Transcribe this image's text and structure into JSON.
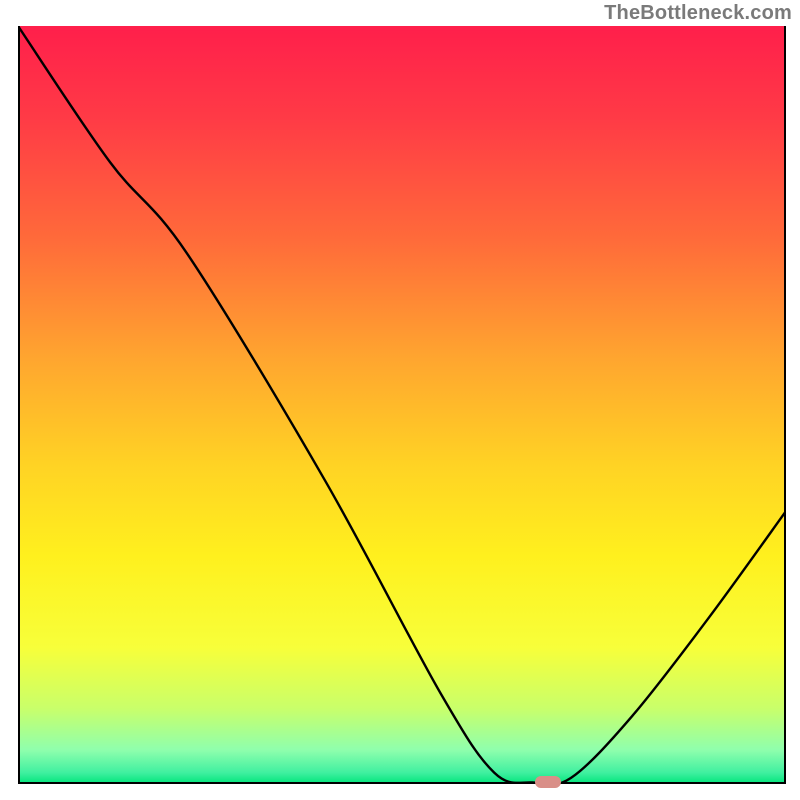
{
  "watermark": "TheBottleneck.com",
  "colors": {
    "gradient_stops": [
      {
        "offset": 0.0,
        "color": "#ff1f4b"
      },
      {
        "offset": 0.12,
        "color": "#ff3a46"
      },
      {
        "offset": 0.28,
        "color": "#ff6a3a"
      },
      {
        "offset": 0.44,
        "color": "#ffa62f"
      },
      {
        "offset": 0.58,
        "color": "#ffd324"
      },
      {
        "offset": 0.7,
        "color": "#fff01e"
      },
      {
        "offset": 0.82,
        "color": "#f7ff3a"
      },
      {
        "offset": 0.9,
        "color": "#c9ff6a"
      },
      {
        "offset": 0.955,
        "color": "#8fffad"
      },
      {
        "offset": 0.985,
        "color": "#40f0a0"
      },
      {
        "offset": 1.0,
        "color": "#00e47a"
      }
    ],
    "curve": "#000000",
    "marker": "#d98f88",
    "axes": "#000000"
  },
  "chart_data": {
    "type": "line",
    "title": "",
    "xlabel": "",
    "ylabel": "",
    "xlim": [
      0,
      100
    ],
    "ylim": [
      0,
      100
    ],
    "curve": [
      {
        "x": 0,
        "y": 100
      },
      {
        "x": 12,
        "y": 82
      },
      {
        "x": 22,
        "y": 70
      },
      {
        "x": 40,
        "y": 40
      },
      {
        "x": 55,
        "y": 12
      },
      {
        "x": 62,
        "y": 1.5
      },
      {
        "x": 67,
        "y": 0.2
      },
      {
        "x": 72,
        "y": 0.8
      },
      {
        "x": 80,
        "y": 9
      },
      {
        "x": 90,
        "y": 22
      },
      {
        "x": 100,
        "y": 36
      }
    ],
    "marker": {
      "x": 69,
      "y": 0.3
    }
  }
}
